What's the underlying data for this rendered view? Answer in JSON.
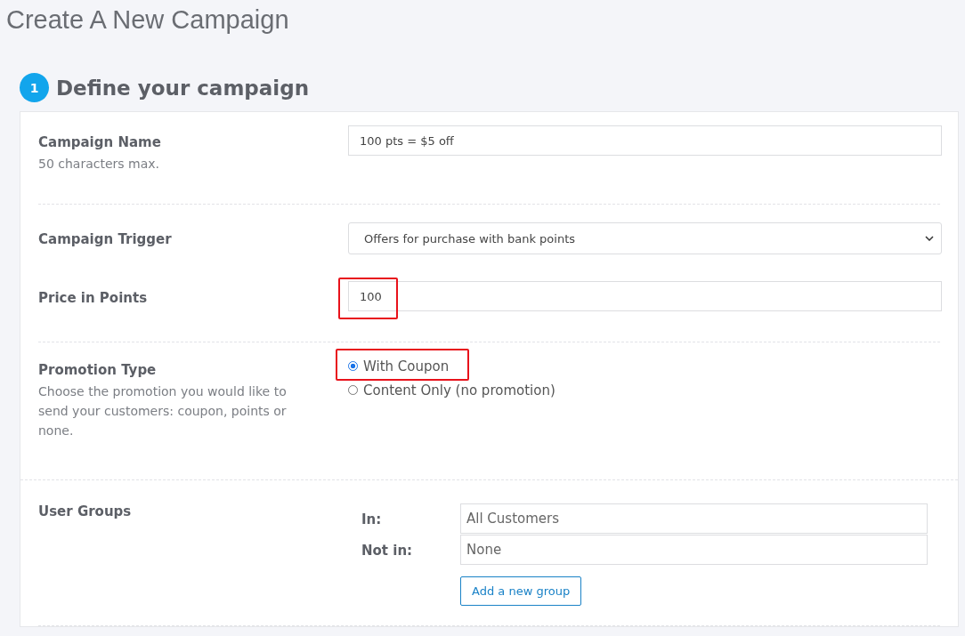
{
  "page_title": "Create A New Campaign",
  "step": {
    "number": "1",
    "title": "Define your campaign"
  },
  "rows": [
    {
      "kind": "text",
      "label": "Campaign Name",
      "hint": "50 characters max.",
      "value": "100 pts = $5 off",
      "divider_after": true
    },
    {
      "kind": "select",
      "label": "Campaign Trigger",
      "value": "Offers for purchase with bank points",
      "divider_after": false
    },
    {
      "kind": "text",
      "label": "Price in Points",
      "value": "100",
      "highlighted": true,
      "divider_after": true
    },
    {
      "kind": "radio",
      "label": "Promotion Type",
      "hint": "Choose the promotion you would like to send your customers: coupon, points or none.",
      "options": [
        {
          "label": "With Coupon",
          "selected": true,
          "highlighted": true
        },
        {
          "label": "Content Only (no promotion)",
          "selected": false,
          "highlighted": false
        }
      ],
      "divider_after": true
    },
    {
      "kind": "groups",
      "label": "User Groups",
      "groups": [
        {
          "label": "In:",
          "value": "All Customers"
        },
        {
          "label": "Not in:",
          "value": "None"
        }
      ],
      "button": "Add a new group",
      "divider_after": true
    }
  ]
}
